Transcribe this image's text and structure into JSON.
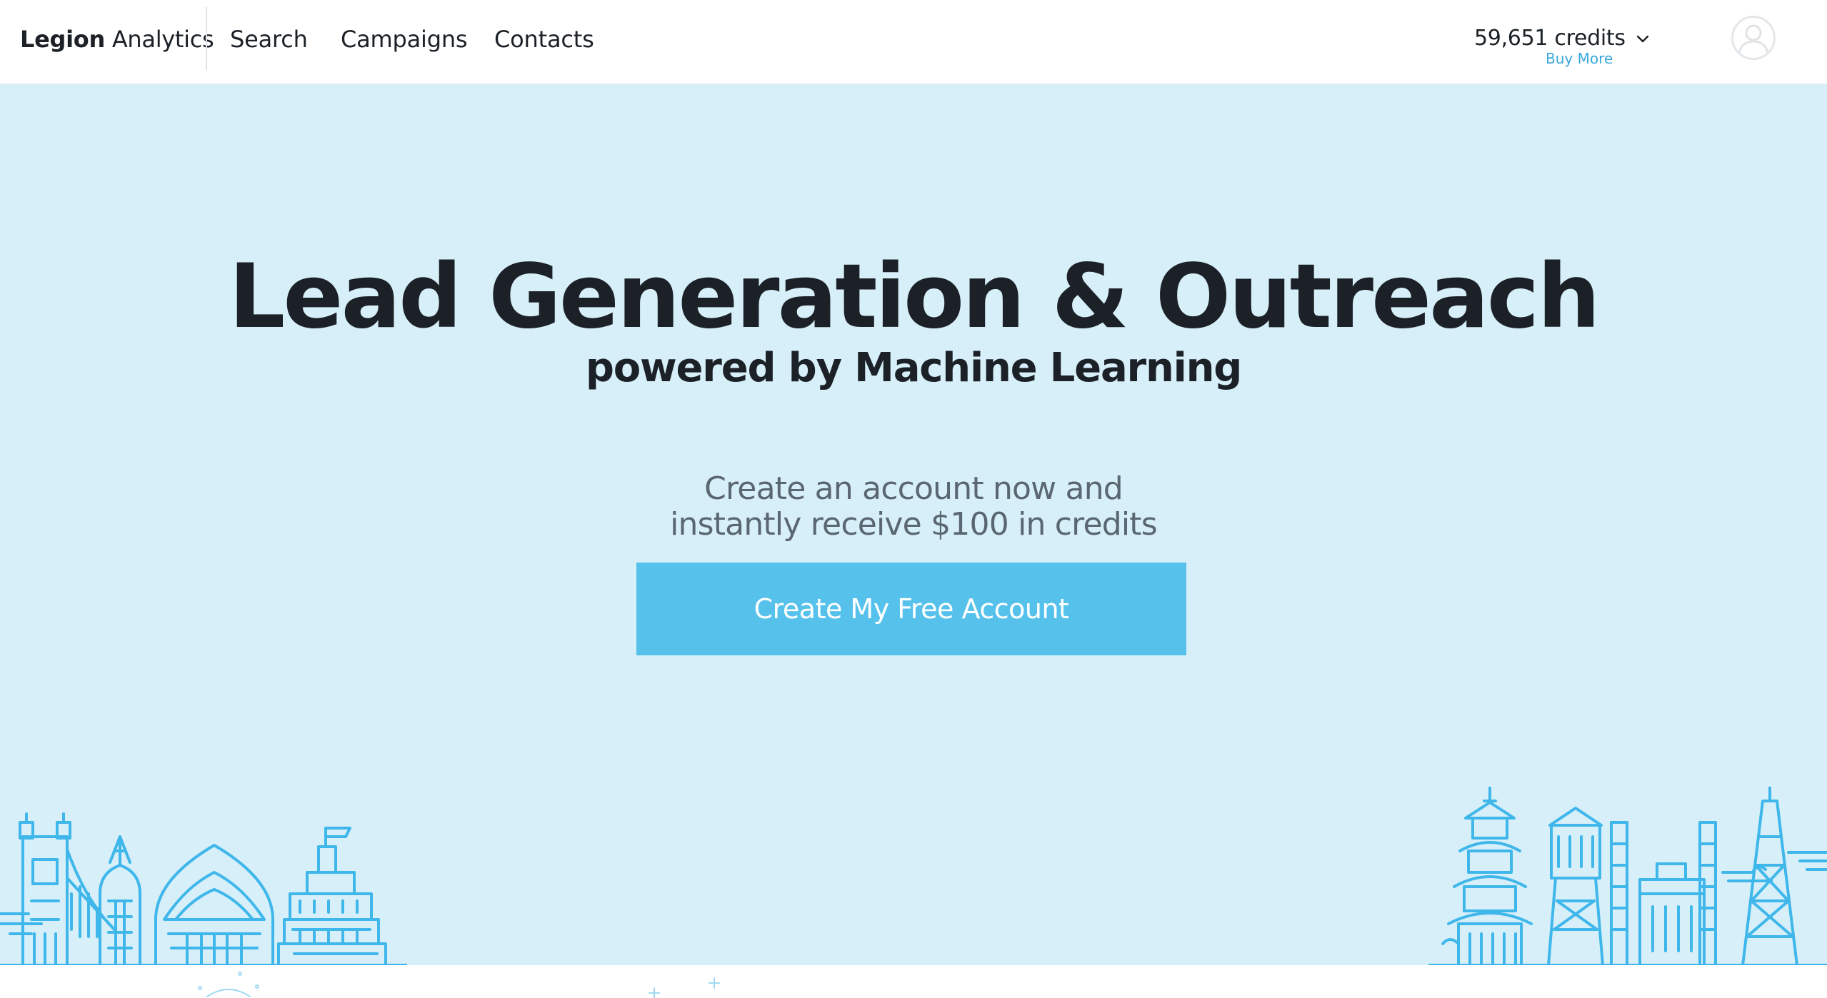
{
  "header": {
    "brand_bold": "Legion",
    "brand_light": "Analytics",
    "nav": {
      "search": "Search",
      "campaigns": "Campaigns",
      "contacts": "Contacts"
    },
    "credits_label": "59,651 credits",
    "buy_more": "Buy More"
  },
  "hero": {
    "headline": "Lead Generation & Outreach",
    "subheadline": "powered by Machine Learning",
    "promo_line1": "Create an account now and",
    "promo_line2": "instantly receive $100 in credits",
    "cta_label": "Create My Free Account"
  },
  "colors": {
    "hero_background": "#d7eff9",
    "cta_background": "#56c2ec",
    "skyline_stroke": "#3fb7ea",
    "link": "#3aa7dc",
    "text_dark": "#1b2126"
  },
  "icons": [
    "chevron-down-icon",
    "user-avatar-icon",
    "city-skyline-left",
    "city-skyline-right"
  ]
}
